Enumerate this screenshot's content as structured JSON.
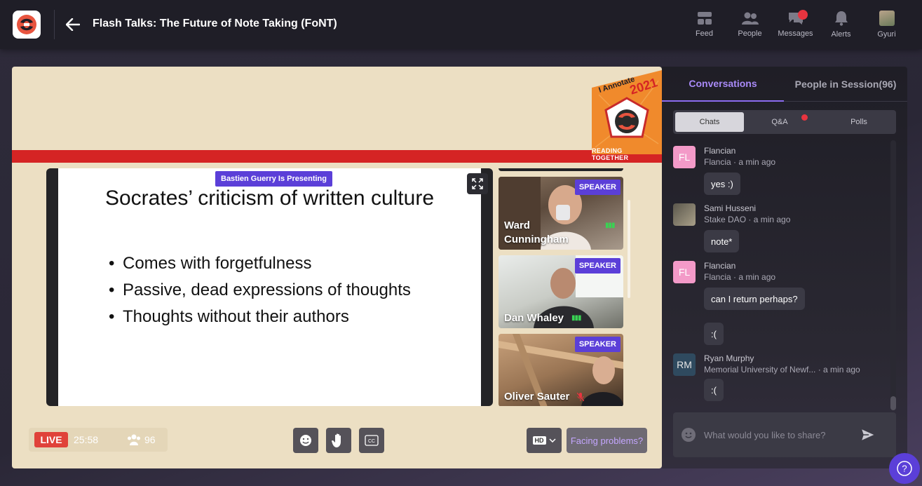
{
  "header": {
    "title": "Flash Talks: The Future of Note Taking (FoNT)",
    "nav": [
      {
        "label": "Feed",
        "icon": "feed-icon"
      },
      {
        "label": "People",
        "icon": "people-icon"
      },
      {
        "label": "Messages",
        "icon": "messages-icon",
        "badge": true
      },
      {
        "label": "Alerts",
        "icon": "bell-icon"
      },
      {
        "label": "Gyuri",
        "icon": "avatar"
      }
    ]
  },
  "stage": {
    "banner": {
      "event_label": "I Annotate",
      "year": "2021",
      "tagline": "READING TOGETHER"
    },
    "presenting_badge": "Bastien Guerry Is Presenting",
    "slide": {
      "title": "Socrates’ criticism of written culture",
      "bullets": [
        "Comes with forgetfulness",
        "Passive, dead expressions of thoughts",
        "Thoughts without their authors"
      ]
    },
    "speakers": [
      {
        "name": "Ward Cunningham",
        "badge": "SPEAKER",
        "audio": "active"
      },
      {
        "name": "Dan Whaley",
        "badge": "SPEAKER",
        "audio": "active"
      },
      {
        "name": "Oliver Sauter",
        "badge": "SPEAKER",
        "audio": "muted"
      }
    ],
    "controls": {
      "live_label": "LIVE",
      "time": "25:58",
      "viewer_count": "96",
      "quality": "HD",
      "problems_label": "Facing problems?"
    }
  },
  "panel": {
    "tabs": {
      "conversations": "Conversations",
      "people": "People in Session(96)"
    },
    "segments": {
      "chats": "Chats",
      "qa": "Q&A",
      "polls": "Polls"
    },
    "messages": [
      {
        "avatar": "FL",
        "name": "Flancian",
        "sub": "Flancia · a min ago",
        "bubbles": [
          "yes :)"
        ]
      },
      {
        "avatar": "",
        "name": "Sami Husseni",
        "sub": "Stake DAO · a min ago",
        "bubbles": [
          "note*"
        ]
      },
      {
        "avatar": "FL",
        "name": "Flancian",
        "sub": "Flancia · a min ago",
        "bubbles": [
          "can I return perhaps?",
          ":("
        ]
      },
      {
        "avatar": "RM",
        "name": "Ryan Murphy",
        "sub": "Memorial University of Newf...   · a min ago",
        "bubbles": [
          ":("
        ]
      }
    ],
    "composer_placeholder": "What would you like to share?"
  },
  "colors": {
    "accent": "#5b3fd8",
    "live": "#e0423a",
    "stripe": "#d52424",
    "stage_bg": "#ecdfc3"
  }
}
